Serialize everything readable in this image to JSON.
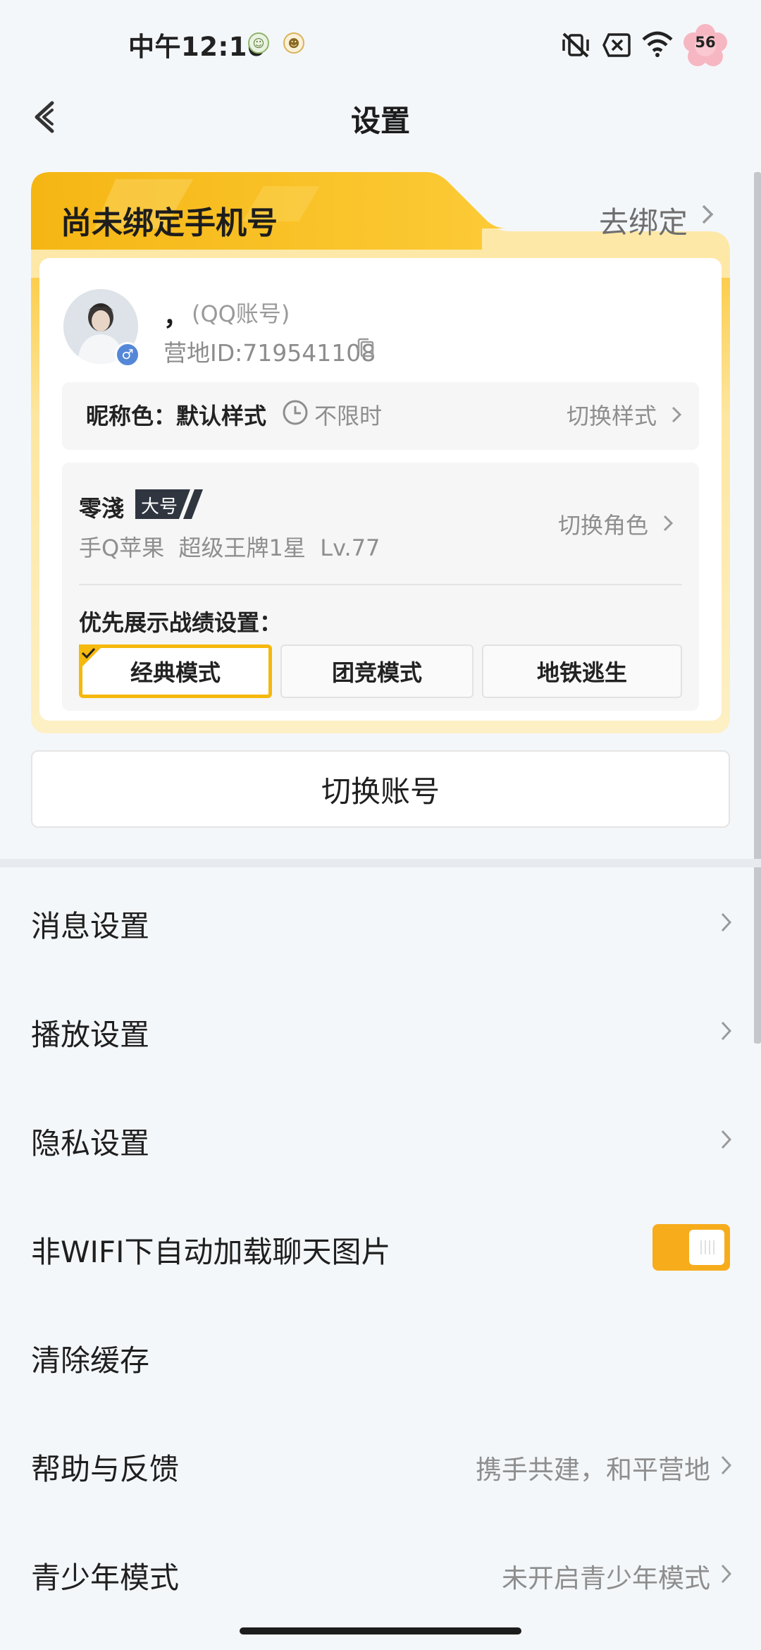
{
  "status_bar": {
    "time": "中午12:10",
    "battery_level": "56",
    "icons": [
      "app-notification-icon",
      "app-notification-icon",
      "vibrate-off-icon",
      "no-sim-icon",
      "wifi-icon",
      "battery-icon"
    ]
  },
  "header": {
    "title": "设置",
    "back_icon": "back-arrow-icon"
  },
  "account_card": {
    "bind_title": "尚未绑定手机号",
    "bind_link": "去绑定",
    "nickname": "，",
    "account_type": "(QQ账号)",
    "camp_id": "营地ID:719541108",
    "gender_symbol": "♂",
    "nickname_color_label": "昵称色：默认样式",
    "time_limit": "不限时",
    "switch_style": "切换样式",
    "role_name": "零淺",
    "role_badge": "大号",
    "role_info": "手Q苹果  超级王牌1星  Lv.77",
    "switch_role": "切换角色",
    "prefer_label": "优先展示战绩设置：",
    "modes": [
      {
        "label": "经典模式",
        "selected": true
      },
      {
        "label": "团竞模式",
        "selected": false
      },
      {
        "label": "地铁逃生",
        "selected": false
      }
    ]
  },
  "switch_account_label": "切换账号",
  "settings": [
    {
      "label": "消息设置",
      "value": "",
      "has_chevron": true
    },
    {
      "label": "播放设置",
      "value": "",
      "has_chevron": true
    },
    {
      "label": "隐私设置",
      "value": "",
      "has_chevron": true
    },
    {
      "label": "非WIFI下自动加载聊天图片",
      "value": "",
      "has_toggle": true,
      "toggle_on": true
    },
    {
      "label": "清除缓存",
      "value": "",
      "has_chevron": false
    },
    {
      "label": "帮助与反馈",
      "value": "携手共建，和平营地",
      "has_chevron": true
    },
    {
      "label": "青少年模式",
      "value": "未开启青少年模式",
      "has_chevron": true
    }
  ],
  "colors": {
    "accent": "#f7ac1b",
    "card_gold": "#f9c32a",
    "background": "#f4f7fa"
  }
}
